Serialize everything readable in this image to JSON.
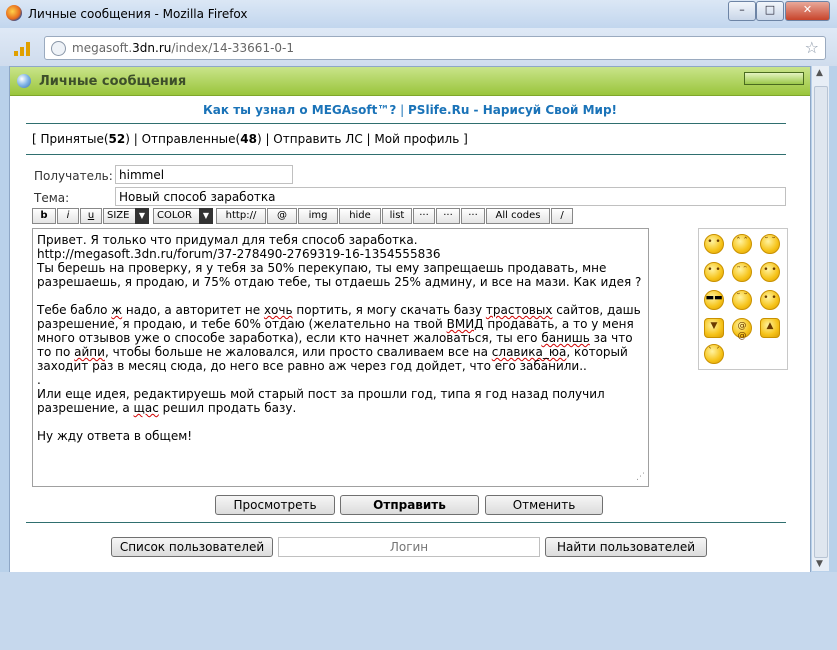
{
  "window": {
    "title": "Личные сообщения - Mozilla Firefox",
    "minimize": "–",
    "maximize": "□",
    "close": "✕"
  },
  "url": {
    "prefix": "megasoft.",
    "domain": "3dn.ru",
    "path": "/index/14-33661-0-1"
  },
  "header": {
    "title": "Личные сообщения"
  },
  "links": {
    "first": "Как ты узнал о MEGAsoft™?",
    "sep": " | ",
    "second": "PSlife.Ru - Нарисуй Свой Мир!"
  },
  "nav": {
    "open": "[ ",
    "received_label": "Принятые",
    "received_count": "52",
    "sent_label": "Отправленные",
    "sent_count": "48",
    "send_pm": "Отправить ЛС",
    "profile": "Мой профиль",
    "close": " ]"
  },
  "form": {
    "recipient_label": "Получатель:",
    "recipient_value": "himmel",
    "subject_label": "Тема:",
    "subject_value": "Новый способ заработка"
  },
  "toolbar": {
    "bold": "b",
    "italic": "i",
    "underline": "u",
    "size": "SIZE",
    "color": "COLOR",
    "http": "http://",
    "email": "@",
    "img": "img",
    "hide": "hide",
    "list": "list",
    "dots1": "···",
    "dots2": "···",
    "dots3": "···",
    "all_codes": "All codes",
    "slash": "/"
  },
  "message": {
    "l1": "Привет. Я только что придумал для тебя способ заработка.",
    "l2": "http://megasoft.3dn.ru/forum/37-278490-2769319-16-1354555836",
    "l3": "Ты берешь на проверку, я у тебя за 50% перекупаю, ты ему запрещаешь продавать, мне разрешаешь, я продаю, и 75% отдаю тебе, ты отдаешь 25% админу, и все на мази. Как идея ?",
    "p2a": "Тебе бабло ",
    "p2b": "ж",
    "p2c": " надо, а авторитет не ",
    "p2d": "хочь",
    "p2e": " портить, я могу скачать базу ",
    "p2f": "трастовых",
    "p2g": " сайтов, дашь разрешение, я продаю, и тебе 60% отдаю (желательно на твой ",
    "p2h": "ВМИД",
    "p2i": " продавать, а то у меня много отзывов уже о способе заработка), если кто начнет жаловаться, ты его ",
    "p2j": "банишь",
    "p2k": " за что то по ",
    "p2l": "айпи",
    "p2m": ", чтобы больше не жаловался, или просто сваливаем все на ",
    "p2n": "славика_юа",
    "p2o": ", который заходит раз в месяц сюда, до него все равно аж через год дойдет, что его забанили..",
    "dot": ".",
    "p3a": "Или еще идея, редактируешь мой старый пост за прошли год, типа я год назад получил разрешение, а ",
    "p3b": "щас",
    "p3c": " решил продать базу.",
    "p4": "Ну жду ответа в общем!"
  },
  "smileys": [
    "smile",
    "sad",
    "cry",
    "happy",
    "laugh",
    "grin",
    "cool",
    "wink",
    "tongue",
    "thumbs-down",
    "crazy",
    "thumbs-up",
    "angry"
  ],
  "buttons": {
    "preview": "Просмотреть",
    "send": "Отправить",
    "cancel": "Отменить"
  },
  "footer": {
    "user_list": "Список пользователей",
    "login_placeholder": "Логин",
    "find_user": "Найти пользователей"
  }
}
